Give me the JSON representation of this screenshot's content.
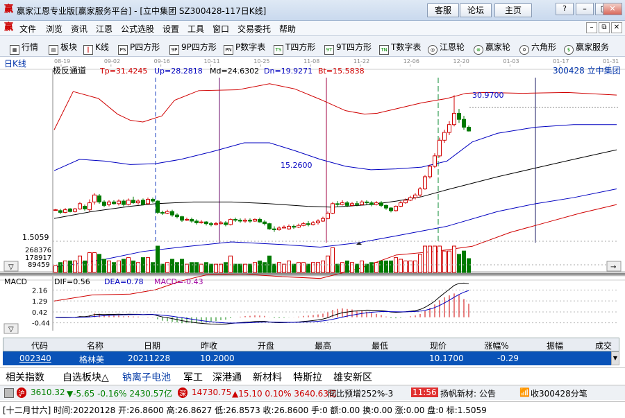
{
  "window": {
    "title": "赢家江恩专业版[赢家服务平台] - [立中集团  SZ300428-117日K线]",
    "buttons": [
      "客服",
      "论坛",
      "主页"
    ],
    "controls": {
      "help": "?",
      "minimize": "–",
      "maximize": "□",
      "close": "✕"
    }
  },
  "menu": {
    "items": [
      "文件",
      "浏览",
      "资讯",
      "江恩",
      "公式选股",
      "设置",
      "工具",
      "窗口",
      "交易委托",
      "帮助"
    ],
    "mdi": {
      "minimize": "–",
      "restore": "⧉",
      "close": "✕"
    }
  },
  "toolbar": {
    "items": [
      {
        "label": "行情",
        "icon": "grid-icon",
        "glyph": "▦"
      },
      {
        "label": "板块",
        "icon": "blocks-icon",
        "glyph": "▤"
      },
      {
        "label": "K线",
        "icon": "candles-icon",
        "glyph": "┃"
      },
      {
        "label": "P四方形",
        "icon": "p-square-icon",
        "glyph": "PS"
      },
      {
        "label": "9P四方形",
        "icon": "9p-square-icon",
        "glyph": "9P"
      },
      {
        "label": "P数字表",
        "icon": "p-number-icon",
        "glyph": "PN"
      },
      {
        "label": "T四方形",
        "icon": "t-square-icon",
        "glyph": "TS"
      },
      {
        "label": "9T四方形",
        "icon": "9t-square-icon",
        "glyph": "9T"
      },
      {
        "label": "T数字表",
        "icon": "t-number-icon",
        "glyph": "TN"
      },
      {
        "label": "江恩轮",
        "icon": "gann-wheel-icon",
        "glyph": "◎"
      },
      {
        "label": "赢家轮",
        "icon": "winner-wheel-icon",
        "glyph": "⊛"
      },
      {
        "label": "六角形",
        "icon": "hexagon-icon",
        "glyph": "✡"
      },
      {
        "label": "赢家服务",
        "icon": "dollar-icon",
        "glyph": "$"
      }
    ]
  },
  "chart_data": {
    "type": "candlestick",
    "panel_title": "日K线",
    "indicator_name": "极反通道",
    "indicator_values": {
      "Tp": "Tp=31.4245",
      "Up": "Up=28.2818",
      "Md": "Md=24.6302",
      "Dn": "Dn=19.9271",
      "Bt": "Bt=15.5838"
    },
    "stock": "300428  立中集团",
    "date_ticks": [
      "08-19",
      "09-02",
      "09-16",
      "10-11",
      "10-25",
      "11-08",
      "11-22",
      "12-06",
      "12-20",
      "01-03",
      "01-17",
      "01-31"
    ],
    "ylim": [
      14.5,
      33
    ],
    "bottom_value": "1.5059",
    "high_label": "30.9700",
    "low_label": "15.2600",
    "volume_ticks": [
      "268376",
      "178917",
      "89459"
    ],
    "volume_max": 300000,
    "candles": [
      [
        17.8,
        17.8,
        17.9,
        17.7
      ],
      [
        17.7,
        17.5,
        17.9,
        17.3
      ],
      [
        17.5,
        17.8,
        18,
        17.4
      ],
      [
        17.9,
        17.6,
        18,
        17.5
      ],
      [
        17.6,
        17.9,
        18,
        17.5
      ],
      [
        17.9,
        18.5,
        18.7,
        17.8
      ],
      [
        18.2,
        17.9,
        18.4,
        17.7
      ],
      [
        17.8,
        18.6,
        19,
        17.6
      ],
      [
        18.7,
        19.5,
        19.7,
        18.4
      ],
      [
        19.4,
        18.7,
        19.6,
        18.5
      ],
      [
        18.7,
        18.3,
        18.9,
        18.1
      ],
      [
        18.4,
        18.7,
        18.9,
        18.2
      ],
      [
        18.7,
        18.5,
        18.9,
        18.4
      ],
      [
        18.5,
        18.8,
        19,
        18.3
      ],
      [
        18.8,
        18.4,
        19,
        18.2
      ],
      [
        18.4,
        18.9,
        19.1,
        18.3
      ],
      [
        18.9,
        18.6,
        19.3,
        18.5
      ],
      [
        18.6,
        18.8,
        19,
        18.4
      ],
      [
        18.9,
        18.4,
        19.1,
        18.3
      ],
      [
        18.5,
        19,
        19.2,
        18.4
      ],
      [
        19,
        18.8,
        19.2,
        18.6
      ],
      [
        18.8,
        17.5,
        18.9,
        17.3
      ],
      [
        17.5,
        17.4,
        17.7,
        17.2
      ],
      [
        17.4,
        17.6,
        17.8,
        17.3
      ],
      [
        17.6,
        17.2,
        17.8,
        17
      ],
      [
        17.2,
        17,
        17.4,
        16.8
      ],
      [
        17.0,
        16.6,
        17.1,
        16.4
      ],
      [
        16.6,
        16.7,
        16.9,
        16.5
      ],
      [
        16.7,
        16.5,
        16.9,
        16.3
      ],
      [
        16.5,
        16.3,
        16.7,
        16.1
      ],
      [
        16.3,
        16.4,
        16.6,
        16.2
      ],
      [
        16.4,
        16.2,
        16.5,
        16
      ],
      [
        16.2,
        16.1,
        16.4,
        15.9
      ],
      [
        16.1,
        16.2,
        16.4,
        16
      ],
      [
        16.2,
        16.3,
        16.5,
        16.1
      ],
      [
        16.3,
        16.1,
        16.5,
        15.9
      ],
      [
        16.1,
        16.7,
        16.8,
        16
      ],
      [
        16.7,
        16.6,
        16.9,
        16.4
      ],
      [
        16.6,
        16.5,
        16.8,
        16.3
      ],
      [
        16.5,
        16.6,
        16.8,
        16.3
      ],
      [
        16.6,
        16.5,
        16.8,
        16.3
      ],
      [
        16.5,
        16.7,
        16.8,
        16.4
      ],
      [
        16.7,
        16.4,
        16.9,
        16.3
      ],
      [
        16.4,
        16.2,
        16.6,
        16
      ],
      [
        16.2,
        15.6,
        16.3,
        15.5
      ],
      [
        15.6,
        15.5,
        15.9,
        15.26
      ],
      [
        15.5,
        15.7,
        15.9,
        15.4
      ],
      [
        15.7,
        15.8,
        16
      ],
      [
        15.6,
        15.9,
        16.1,
        15.5
      ],
      [
        15.9,
        15.8,
        16.1,
        15.6
      ],
      [
        15.8,
        16.0,
        16.2,
        15.7
      ],
      [
        16.0,
        16.2,
        16.4,
        15.9
      ],
      [
        16.2,
        16.1,
        16.5,
        15.9
      ],
      [
        16.1,
        16.3,
        16.5,
        16
      ],
      [
        16.3,
        16.5,
        16.7,
        16.1
      ],
      [
        16.5,
        16.8,
        17,
        16.4
      ],
      [
        16.8,
        17.4,
        17.6,
        16.7
      ],
      [
        17.4,
        18.5,
        18.7,
        17.3
      ],
      [
        18.5,
        18.4,
        18.8,
        18.1
      ],
      [
        18.4,
        18.6,
        18.9,
        18.3
      ],
      [
        18.6,
        18.3,
        18.8,
        18.1
      ],
      [
        18.3,
        18.5,
        18.7,
        18.2
      ],
      [
        18.5,
        18.4,
        18.8,
        18.2
      ],
      [
        18.4,
        18.7,
        18.9,
        18.3
      ],
      [
        18.7,
        18.6,
        18.9,
        18.4
      ],
      [
        18.6,
        18.4,
        18.8,
        18.2
      ],
      [
        18.4,
        18.6,
        18.8,
        18.3
      ],
      [
        18.6,
        18.3,
        18.8,
        18.1
      ],
      [
        18.3,
        18.0,
        18.4,
        17.8
      ],
      [
        18.0,
        17.7,
        18.1,
        17.5
      ],
      [
        17.7,
        18.2,
        18.3,
        17.6
      ],
      [
        18.2,
        18.6,
        18.8,
        18.1
      ],
      [
        18.6,
        18.9,
        19.1,
        18.5
      ],
      [
        18.9,
        19.2,
        19.4,
        18.8
      ],
      [
        19.2,
        19.5,
        19.7,
        19
      ],
      [
        19.5,
        20.2,
        20.4,
        19.3
      ],
      [
        20.2,
        21.6,
        21.8,
        20.1
      ],
      [
        21.6,
        22.8,
        23,
        21.4
      ],
      [
        22.8,
        24.0,
        24.3,
        22.6
      ],
      [
        24,
        25.8,
        26.1,
        23.8
      ],
      [
        25.8,
        26.7,
        27.0,
        25.5
      ],
      [
        26.7,
        27.6,
        28.0,
        26.4
      ],
      [
        27.6,
        28.9,
        30.97,
        27.4
      ],
      [
        28.9,
        28.2,
        29.4,
        27.8
      ],
      [
        28.2,
        27.3,
        28.6,
        27.0
      ],
      [
        27.3,
        26.86,
        27.5,
        26.8
      ]
    ],
    "channel": {
      "upper": [
        [
          0,
          27
        ],
        [
          30,
          31.4
        ],
        [
          70,
          30.6
        ],
        [
          100,
          28.8
        ],
        [
          120,
          28.1
        ],
        [
          140,
          27.9
        ],
        [
          170,
          28.6
        ],
        [
          190,
          30.4
        ],
        [
          228,
          31.5
        ],
        [
          290,
          31.6
        ],
        [
          340,
          32.3
        ],
        [
          380,
          31.7
        ],
        [
          420,
          30.5
        ],
        [
          460,
          29.2
        ],
        [
          490,
          28.8
        ],
        [
          510,
          28.9
        ],
        [
          545,
          29.5
        ],
        [
          580,
          30.1
        ],
        [
          620,
          30.6
        ],
        [
          650,
          31.2
        ],
        [
          680,
          31.3
        ],
        [
          740,
          31.2
        ],
        [
          810,
          31.3
        ],
        [
          888,
          31.0
        ]
      ],
      "up": [
        [
          0,
          22.3
        ],
        [
          40,
          23.6
        ],
        [
          80,
          23.4
        ],
        [
          120,
          23.0
        ],
        [
          160,
          23.1
        ],
        [
          200,
          23.6
        ],
        [
          250,
          24.5
        ],
        [
          300,
          25.5
        ],
        [
          340,
          25.5
        ],
        [
          380,
          24.6
        ],
        [
          420,
          23.6
        ],
        [
          460,
          22.8
        ],
        [
          500,
          22.4
        ],
        [
          540,
          22.5
        ],
        [
          580,
          22.7
        ],
        [
          620,
          23.4
        ],
        [
          660,
          25.6
        ],
        [
          700,
          26.6
        ],
        [
          760,
          27.3
        ],
        [
          820,
          27.6
        ],
        [
          888,
          27.6
        ]
      ],
      "mid": [
        [
          0,
          16.8
        ],
        [
          60,
          17.6
        ],
        [
          120,
          18.2
        ],
        [
          160,
          18.5
        ],
        [
          220,
          18.7
        ],
        [
          280,
          18.7
        ],
        [
          340,
          18.5
        ],
        [
          400,
          18.2
        ],
        [
          440,
          18.1
        ],
        [
          500,
          18.4
        ],
        [
          540,
          18.8
        ],
        [
          580,
          19.3
        ],
        [
          620,
          20.1
        ],
        [
          700,
          21.6
        ],
        [
          760,
          22.6
        ],
        [
          820,
          23.6
        ],
        [
          888,
          24.7
        ]
      ],
      "dn": [
        [
          0,
          11.2
        ],
        [
          80,
          12.1
        ],
        [
          140,
          13.0
        ],
        [
          200,
          13.5
        ],
        [
          280,
          14.1
        ],
        [
          360,
          13.8
        ],
        [
          420,
          13.5
        ],
        [
          480,
          14.0
        ],
        [
          540,
          14.8
        ],
        [
          620,
          15.9
        ],
        [
          700,
          17.6
        ],
        [
          760,
          18.5
        ],
        [
          820,
          19.2
        ],
        [
          888,
          20.2
        ]
      ],
      "lower": [
        [
          0,
          7.3
        ],
        [
          60,
          8.0
        ],
        [
          120,
          8.1
        ],
        [
          160,
          8.6
        ],
        [
          200,
          9.6
        ],
        [
          240,
          10.3
        ],
        [
          300,
          10.4
        ],
        [
          360,
          10.1
        ],
        [
          420,
          9.9
        ],
        [
          480,
          11.0
        ],
        [
          540,
          12.6
        ],
        [
          600,
          13.0
        ],
        [
          660,
          13.6
        ],
        [
          720,
          15.2
        ],
        [
          780,
          16.4
        ],
        [
          830,
          17.4
        ],
        [
          888,
          18.4
        ]
      ]
    },
    "macd": {
      "label": "MACD",
      "dif": "DIF=0.56",
      "dea": "DEA=0.78",
      "macd": "MACD=-0.43",
      "ticks": [
        "2.16",
        "1.29",
        "0.42",
        "-0.44"
      ],
      "ylim": [
        -0.9,
        2.4
      ]
    }
  },
  "table": {
    "headers": [
      "代码",
      "名称",
      "日期",
      "昨收",
      "开盘",
      "最高",
      "最低",
      "现价",
      "涨幅%",
      "振幅",
      "成交"
    ],
    "row": [
      "002340",
      "格林美",
      "20211228",
      "10.2000",
      "",
      "",
      "",
      "10.1700",
      "-0.29",
      "",
      ""
    ]
  },
  "tabs": [
    "相关指数",
    "自选板块△",
    "钠离子电池",
    "军工",
    "深港通",
    "新材料",
    "特斯拉",
    "雄安新区"
  ],
  "status": {
    "sh": "3610.32",
    "sh_change": "▼-5.65 -0.16% 2430.57亿",
    "sz": "14730.75",
    "sz_change": "▲15.10 0.10% 3640.63亿",
    "news1": "同比预增252%-3",
    "time": "11:56",
    "news2": "扬帆新材: 公告",
    "alert": "收300428分笔"
  },
  "info": "[十二月廿六] 时间:20220128 开:26.8600 高:26.8627 低:26.8573 收:26.8600 手:0 额:0.00 换:0.00 涨:0.00 盘:0 标:1.5059"
}
